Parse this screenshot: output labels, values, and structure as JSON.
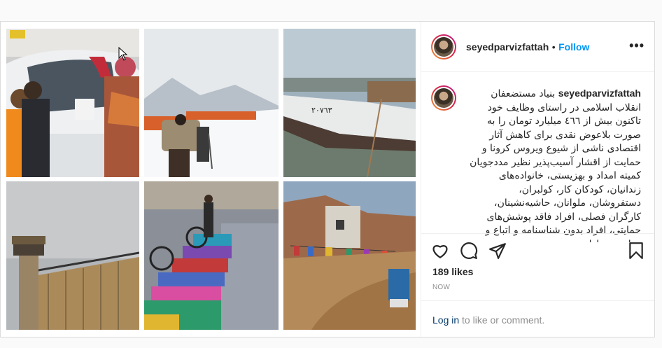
{
  "post": {
    "username": "seyedparvizfattah",
    "dot": "•",
    "follow_label": "Follow",
    "more_label": "•••",
    "caption_username": "seyedparvizfattah",
    "caption_text": "بنیاد مستضعفان انقلاب اسلامی در راستای وظایف خود تاکنون بیش از ٤٦٦ میلیارد تومان را به صورت بلاعوض نقدی برای کاهش آثار اقتصادی ناشی از شیوع ویروس کرونا و حمایت از اقشار آسیب‌پذیر نظیر مددجویان کمیته امداد و بهزیستی، خانواده‌های زندانیان، کودکان کار، کولبران، دستفروشان، ملوانان، حاشیه‌نشینان، کارگران فصلی، افراد فاقد پوشش‌های حمایتی، افراد بدون شناسنامه و اتباع و مهاجرین دارای",
    "likes": "189 likes",
    "timestamp": "NOW",
    "login_label": "Log in",
    "comment_suffix": " to like or comment."
  },
  "icons": [
    "heart-icon",
    "comment-icon",
    "share-icon",
    "bookmark-icon",
    "more-options-icon",
    "mouse-cursor-icon"
  ],
  "colors": {
    "follow": "#0095f6",
    "login": "#00376b",
    "muted": "#8e8e8e",
    "text": "#262626"
  }
}
